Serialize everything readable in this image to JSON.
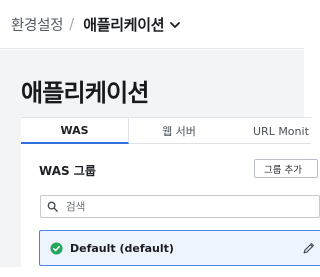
{
  "breadcrumb": {
    "parent": "환경설정",
    "separator": "/",
    "current": "애플리케이션"
  },
  "page": {
    "title": "애플리케이션"
  },
  "tabs": [
    {
      "label": "WAS",
      "active": true
    },
    {
      "label": "웹 서버",
      "active": false
    },
    {
      "label": "URL Monit",
      "active": false
    }
  ],
  "was_group": {
    "title": "WAS 그룹",
    "add_button": "그룹 추가",
    "search_placeholder": "검색",
    "items": [
      {
        "label": "Default (default)",
        "status": "ok",
        "selected": true
      }
    ]
  },
  "colors": {
    "accent": "#2f6fde",
    "status_ok": "#26a65b",
    "selected_bg": "#eef4fe"
  },
  "icons": {
    "breadcrumb_dropdown": "chevron-down-icon",
    "search": "search-icon",
    "status": "check-circle-icon",
    "edit": "pencil-icon"
  }
}
